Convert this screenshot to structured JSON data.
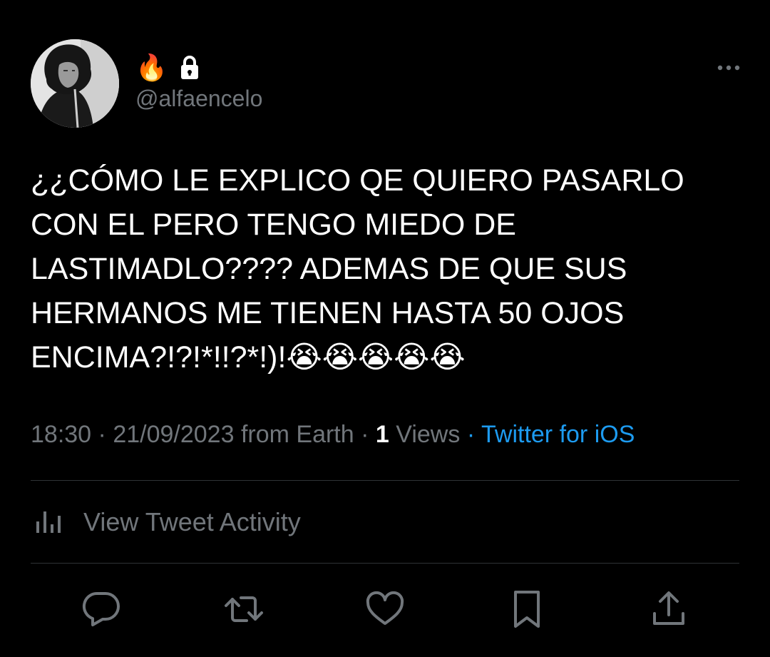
{
  "user": {
    "display_name_emoji": "🔥",
    "handle": "@alfaencelo"
  },
  "tweet": {
    "text": "¿¿CÓMO LE EXPLICO QE QUIERO PASARLO\nCON EL PERO TENGO MIEDO DE\nLASTIMADLO???? ADEMAS DE QUE SUS\nHERMANOS ME TIENEN HASTA 50 OJOS\nENCIMA?!?!*!!?*!)!😭😭😭😭😭"
  },
  "meta": {
    "time": "18:30",
    "date": "21/09/2023",
    "location": "from Earth",
    "separator": "·",
    "views_count": "1",
    "views_label": "Views",
    "source": "Twitter for iOS"
  },
  "activity": {
    "label": "View Tweet Activity"
  },
  "actions": [
    "reply",
    "retweet",
    "like",
    "bookmark",
    "share"
  ],
  "colors": {
    "background": "#000000",
    "text": "#ffffff",
    "secondary": "#71767b",
    "link": "#1d9bf0",
    "divider": "#2f3336"
  }
}
